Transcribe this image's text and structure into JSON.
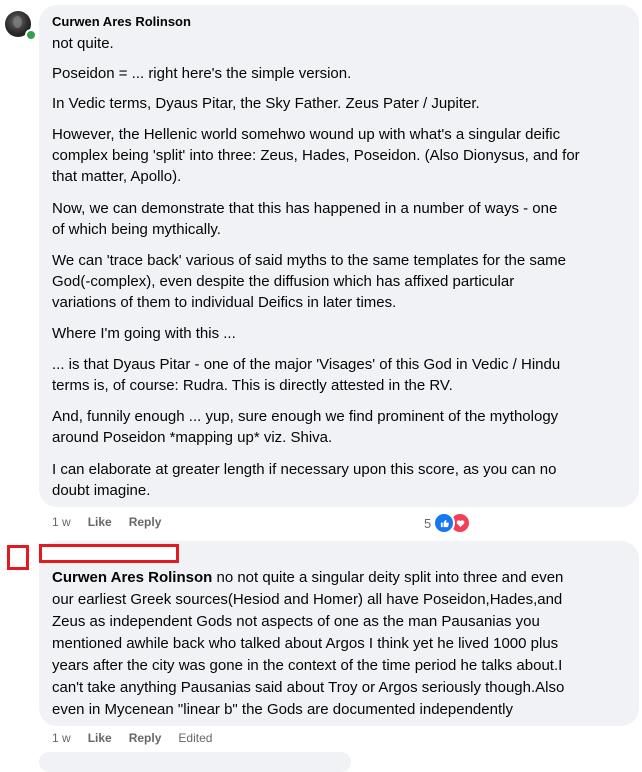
{
  "comment1": {
    "author": "Curwen Ares Rolinson",
    "paragraphs": [
      "not quite.",
      "Poseidon = ... right here's the simple version.",
      "In Vedic terms, Dyaus Pitar, the Sky Father. Zeus Pater / Jupiter.",
      "However, the Hellenic world somehwo wound up with what's a singular deific\ncomplex being 'split' into three: Zeus, Hades, Poseidon. (Also Dionysus, and for\nthat matter, Apollo).",
      "Now, we can demonstrate that this has happened in a number of ways - one\nof which being mythically.",
      "We can 'trace back' various of said myths to the same templates for the same\nGod(-complex), even despite the diffusion which has affixed particular\nvariations of them to individual Deifics in later times.",
      "Where I'm going with this ...",
      "... is that Dyaus Pitar - one of the major 'Visages' of this God in Vedic / Hindu\nterms is, of course: Rudra. This is directly attested in the RV.",
      "And, funnily enough ... yup, sure enough we find prominent of the mythology\naround Poseidon *mapping up* viz. Shiva.",
      "I can elaborate at greater length if necessary upon this score, as you can no\ndoubt imagine."
    ],
    "time": "1 w",
    "like_label": "Like",
    "reply_label": "Reply",
    "reaction_count": "5",
    "reaction_icons": [
      "like-icon",
      "love-icon"
    ],
    "colors": {
      "like": "#1877f2",
      "love": "#f33e58"
    }
  },
  "comment2": {
    "mention": "Curwen Ares Rolinson",
    "text": " no not quite a singular deity split into three and even\nour earliest Greek sources(Hesiod and Homer) all have Poseidon,Hades,and\nZeus as independent Gods not aspects of one as the man Pausanias you\nmentioned awhile back who talked about Argos I think yet he lived 1000 plus\nyears after the city was gone in the context of the time period he talks about.I\ncan't take anything Pausanias said about Troy or Argos seriously though.Also\neven in Mycenean \"linear b\" the Gods are documented independently",
    "time": "1 w",
    "like_label": "Like",
    "reply_label": "Reply",
    "edited_label": "Edited",
    "redaction_color": "#e21b22"
  }
}
